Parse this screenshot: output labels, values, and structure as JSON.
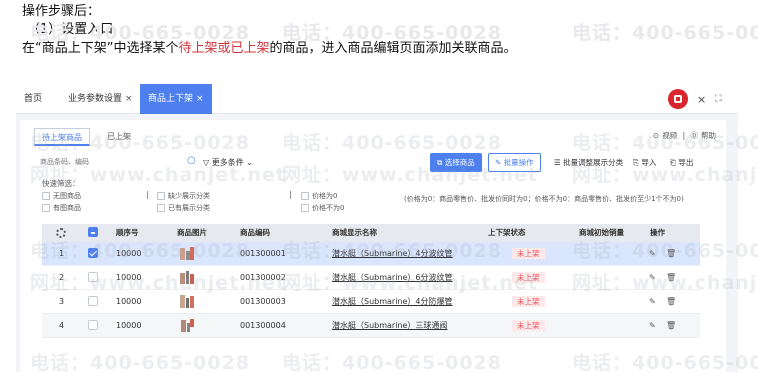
{
  "doc": {
    "line1": "操作步骤后：",
    "line2": "（1）设置入口",
    "line3_before": "在“商品上下架”中选择某个",
    "line3_highlight": "待上架或已上架",
    "line3_after": "的商品，进入商品编辑页面添加关联商品。"
  },
  "watermarks": {
    "phone": "电话：400-665-0028",
    "site": "网址：www.chanjet.net",
    "site_short": "网址：www.chanjet.n"
  },
  "topbar": {
    "tabs": [
      {
        "label": "首页",
        "closable": false,
        "active": false
      },
      {
        "label": "业务参数设置",
        "closable": true,
        "active": false
      },
      {
        "label": "商品上下架",
        "closable": true,
        "active": true
      }
    ],
    "close_glyph": "×",
    "window_close": "×",
    "expand": "⛶"
  },
  "subtabs": [
    {
      "label": "待上架商品",
      "active": true
    },
    {
      "label": "已上架",
      "active": false
    }
  ],
  "help": {
    "video": "视频",
    "help": "帮助"
  },
  "search": {
    "placeholder": "商品条码、编码"
  },
  "more_conditions": "更多条件",
  "buttons": {
    "select": "选择商品",
    "batch": "批量操作",
    "batch_category": "批量调整展示分类",
    "import": "导入",
    "export": "导出"
  },
  "quick_filter": {
    "label": "快速筛选：",
    "items": [
      "无图商品",
      "有图商品",
      "缺少展示分类",
      "已有展示分类",
      "价格为0",
      "价格不为0"
    ],
    "note": "(价格为0：商品零售价、批发价同时为0；价格不为0：商品零售价、批发价至少1个不为0)"
  },
  "table": {
    "headers": [
      "",
      "顺序号",
      "商品图片",
      "商品编码",
      "商城显示名称",
      "上下架状态",
      "商城初始销量",
      "操作"
    ],
    "rows": [
      {
        "index": "1",
        "checked": true,
        "seq": "10000",
        "code": "001300001",
        "name": "潜水艇（Submarine）4分波纹管",
        "status": "未上架"
      },
      {
        "index": "2",
        "checked": false,
        "seq": "10000",
        "code": "001300002",
        "name": "潜水艇（Submarine）6分波纹管",
        "status": "未上架"
      },
      {
        "index": "3",
        "checked": false,
        "seq": "10000",
        "code": "001300003",
        "name": "潜水艇（Submarine）4分防爆管",
        "status": "未上架"
      },
      {
        "index": "4",
        "checked": false,
        "seq": "10000",
        "code": "001300004",
        "name": "潜水艇（Submarine）三球通阀",
        "status": "未上架"
      }
    ]
  },
  "colors": {
    "accent": "#4d7fee",
    "danger": "#d9262c",
    "highlight_text": "#d0343a"
  },
  "icons": [
    "search-icon",
    "filter-icon",
    "select-icon",
    "edit-icon",
    "list-icon",
    "import-icon",
    "export-icon",
    "play-icon",
    "help-icon",
    "gear-icon",
    "delete-icon",
    "close-icon",
    "expand-icon"
  ]
}
